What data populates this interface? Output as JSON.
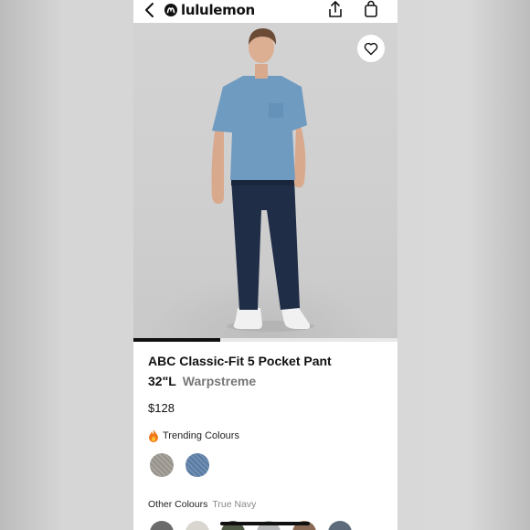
{
  "header": {
    "brand": "lululemon",
    "icons": [
      "back-chevron-icon",
      "lululemon-logo-icon",
      "share-icon",
      "shopping-bag-icon"
    ]
  },
  "gallery": {
    "favourite_icon": "heart-icon",
    "progress_fraction": 0.33
  },
  "product": {
    "name": "ABC Classic-Fit 5 Pocket Pant",
    "inseam": "32\"L",
    "fabric": "Warpstreme",
    "price": "$128"
  },
  "trending": {
    "icon": "fire-icon",
    "label": "Trending Colours",
    "swatches": [
      {
        "color": "#a29f99"
      },
      {
        "color": "#6786ab"
      }
    ]
  },
  "other_colours": {
    "label": "Other Colours",
    "selected": "True Navy",
    "swatches": [
      {
        "color": "#6b6b6b"
      },
      {
        "color": "#d8d6cf"
      },
      {
        "color": "#4f5a45"
      },
      {
        "color": "#b5b7b8"
      },
      {
        "color": "#8a6a55"
      },
      {
        "color": "#5d6b7a"
      }
    ]
  }
}
